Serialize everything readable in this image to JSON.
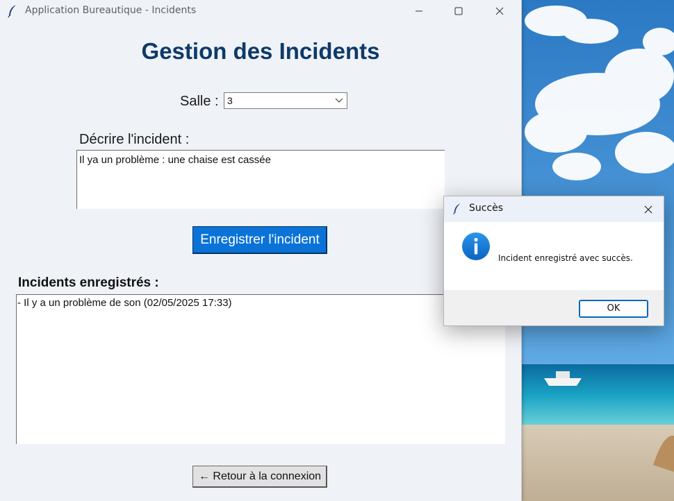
{
  "window": {
    "title": "Application Bureautique - Incidents",
    "icon": "feather-icon"
  },
  "main": {
    "heading": "Gestion des Incidents",
    "salle_label": "Salle :",
    "salle_value": "3",
    "description_label": "Décrire l'incident :",
    "description_text": "Il ya un problème : une chaise est cassée",
    "save_button": "Enregistrer l'incident",
    "list_label": "Incidents enregistrés :",
    "incidents": [
      "- Il y a un problème de son (02/05/2025 17:33)"
    ],
    "back_button": "← Retour à la connexion"
  },
  "dialog": {
    "title": "Succès",
    "message": "Incident enregistré avec succès.",
    "ok_button": "OK",
    "icon": "info-icon"
  },
  "colors": {
    "accent": "#0b73d8",
    "heading": "#0e3a6a",
    "window_bg": "#eff2f7"
  }
}
